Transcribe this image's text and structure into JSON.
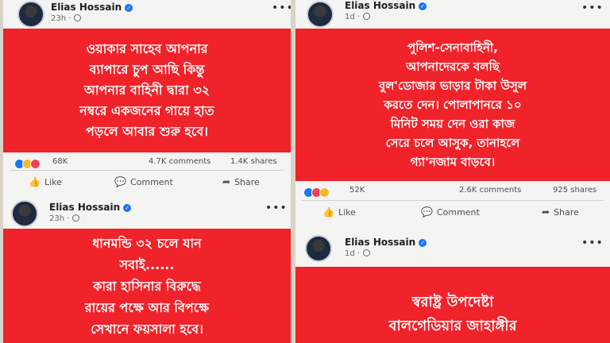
{
  "posts": [
    {
      "author": "Elias Hossain",
      "time": "23h",
      "text": "ওয়াকার সাহেব আপনার\nব্যাপারে চুপ আছি কিন্তু\nআপনার বাহিনী দ্বারা ৩২\nনম্বরে একজনের গায়ে হাত\nপড়লে আবার শুরু হবে।",
      "reactions_count": "68K",
      "comments": "4.7K comments",
      "shares": "1.4K shares"
    },
    {
      "author": "Elias Hossain",
      "time": "23h",
      "text": "ধানমন্ডি ৩২ চলে যান\nসবাই......\nকারা হাসিনার বিরুদ্ধে\nরায়ের পক্ষে আর বিপক্ষে\nসেখানে ফয়সালা হবে।"
    },
    {
      "author": "Elias Hossain",
      "time": "1d",
      "text": "পুলিশ-সেনাবাহিনী,\nআপনাদেরকে বলছি\nবুল'ডোজার ভাড়ার টাকা উসুল\nকরতে দেন। পোলাপানরে ১০\nমিনিট সময় দেন ওরা কাজ\nসেরে চলে আসুক, তানাহলে\nগ্যা'নজাম বাড়বে।",
      "reactions_count": "52K",
      "comments": "2.6K comments",
      "shares": "925 shares"
    },
    {
      "author": "Elias Hossain",
      "time": "1d",
      "text": "স্বরাষ্ট্র উপদেষ্টা\nবালগেডিয়ার জাহাঙ্গীর"
    }
  ],
  "actions": {
    "like": "Like",
    "comment": "Comment",
    "share": "Share"
  },
  "more": "•••",
  "colors": {
    "post_bg": "#f0222a",
    "panel_bg": "#f4f4f2",
    "verified": "#1877f2"
  }
}
